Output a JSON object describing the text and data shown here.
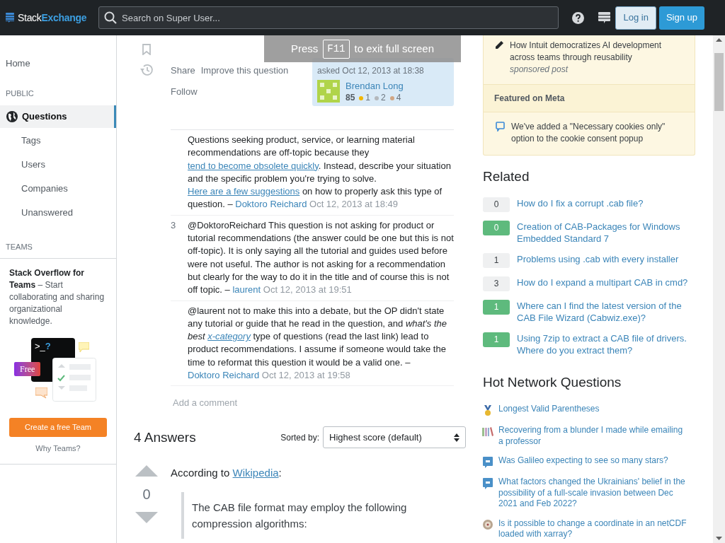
{
  "header": {
    "logo": [
      "Stack",
      "Exchange"
    ],
    "search": {
      "placeholder": "Search on Super User..."
    },
    "buttons": [
      {
        "label": "Log in",
        "kind": "secondary"
      },
      {
        "label": "Sign up",
        "kind": "primary"
      }
    ]
  },
  "fullscreen_notice": {
    "before": "Press",
    "key": "F11",
    "after": "to exit full screen"
  },
  "sidebar": {
    "items": [
      {
        "kind": "link",
        "label": "Home",
        "selected": false
      },
      {
        "kind": "heading",
        "label": "PUBLIC"
      },
      {
        "kind": "section",
        "label": "Questions",
        "selected": true
      },
      {
        "kind": "sublink",
        "label": "Tags",
        "selected": false
      },
      {
        "kind": "sublink",
        "label": "Users",
        "selected": false
      },
      {
        "kind": "sublink",
        "label": "Companies",
        "selected": false
      },
      {
        "kind": "sublink",
        "label": "Unanswered",
        "selected": false
      },
      {
        "kind": "heading",
        "label": "TEAMS"
      }
    ],
    "teams_card": {
      "text": "**Stack Overflow for Teams** – Start collaborating and sharing organizational knowledge.",
      "terminal": ">_",
      "terminal_mark": "?",
      "tag": "Free",
      "button": "Create a free Team",
      "link": "Why Teams?"
    }
  },
  "question": {
    "actions": [
      "Share",
      "Improve this question",
      "Follow"
    ],
    "asked": {
      "label": "asked Oct 12, 2013 at 18:38",
      "user": "Brendan Long",
      "reputation": "85",
      "badges": [
        {
          "count": "1",
          "color": "#f1b600"
        },
        {
          "count": "2",
          "color": "#b4b8bc"
        },
        {
          "count": "4",
          "color": "#d1a684"
        }
      ]
    },
    "comments": [
      {
        "parts": [
          {
            "kind": "text",
            "text": "Questions seeking product, service, or learning material recommendations are off-topic because they "
          },
          {
            "kind": "link",
            "text": "tend to become obsolete quickly"
          },
          {
            "kind": "text",
            "text": ". Instead, describe your situation and the specific problem you're trying to solve. "
          },
          {
            "kind": "link",
            "text": "Here are a few suggestions"
          },
          {
            "kind": "text",
            "text": " on how to properly ask this type of question."
          }
        ],
        "dash": "–",
        "author": "Doktoro Reichard",
        "date": "Oct 12, 2013 at 18:49"
      },
      {
        "score": "3",
        "parts": [
          {
            "kind": "text",
            "text": "@DoktoroReichard This question is not asking for product or tutorial recommendations (the answer could be one but this is not off-topic). It is only saying all the tutorial and guides used before were not useful. The author is not asking for a recommendation but clearly for the way to do it in the title and of course this is not off topic."
          }
        ],
        "dash": "–",
        "author": "laurent",
        "date": "Oct 12, 2013 at 19:51"
      },
      {
        "parts": [
          {
            "kind": "text",
            "text": "@laurent not to make this into a debate, but the OP didn't state any tutorial or guide that he read in the question, and "
          },
          {
            "kind": "italic",
            "text": "what's the best "
          },
          {
            "kind": "italic_link",
            "text": "x-category"
          },
          {
            "kind": "text",
            "text": " type of questions (read the last link) lead to product recommendations. I assume if someone would take the time to reformat this question it would be a valid one."
          }
        ],
        "dash": "–",
        "author": "Doktoro Reichard",
        "date": "Oct 12, 2013 at 19:58"
      }
    ],
    "add_comment": "Add a comment"
  },
  "answers": {
    "count_label": "4 Answers",
    "sort_label": "Sorted by:",
    "sort_value": "Highest score (default)",
    "first": {
      "score": "0",
      "intro": "According to ",
      "link": "Wikipedia",
      "intro_end": ":",
      "quote": "The CAB file format may employ the following compression algorithms:"
    }
  },
  "right": {
    "blog": {
      "title": "How Intuit democratizes AI development across teams through reusability",
      "note": "sponsored post"
    },
    "meta": {
      "heading": "Featured on Meta",
      "item": "We've added a \"Necessary cookies only\" option to the cookie consent popup"
    },
    "related": {
      "heading": "Related",
      "items": [
        {
          "score": "0",
          "answered": false,
          "title": "How do I fix a corrupt .cab file?"
        },
        {
          "score": "0",
          "answered": true,
          "title": "Creation of CAB-Packages for Windows Embedded Standard 7"
        },
        {
          "score": "1",
          "answered": false,
          "title": "Problems using .cab with every installer"
        },
        {
          "score": "3",
          "answered": false,
          "title": "How do I expand a multipart CAB in cmd?"
        },
        {
          "score": "1",
          "answered": true,
          "title": "Where can I find the latest version of the CAB File Wizard (Cabwiz.exe)?"
        },
        {
          "score": "1",
          "answered": true,
          "title": "Using 7zip to extract a CAB file of drivers. Where do you extract them?"
        }
      ]
    },
    "hot": {
      "heading": "Hot Network Questions",
      "items": [
        {
          "kind": "medal",
          "title": "Longest Valid Parentheses"
        },
        {
          "kind": "books",
          "title": "Recovering from a blunder I made while emailing a professor"
        },
        {
          "kind": "bubble",
          "title": "Was Galileo expecting to see so many stars?"
        },
        {
          "kind": "bubble",
          "title": "What factors changed the Ukrainians' belief in the possibility of a full-scale invasion between Dec 2021 and Feb 2022?"
        },
        {
          "kind": "compass",
          "title": "Is it possible to change a coordinate in an netCDF loaded with xarray?"
        }
      ]
    }
  }
}
